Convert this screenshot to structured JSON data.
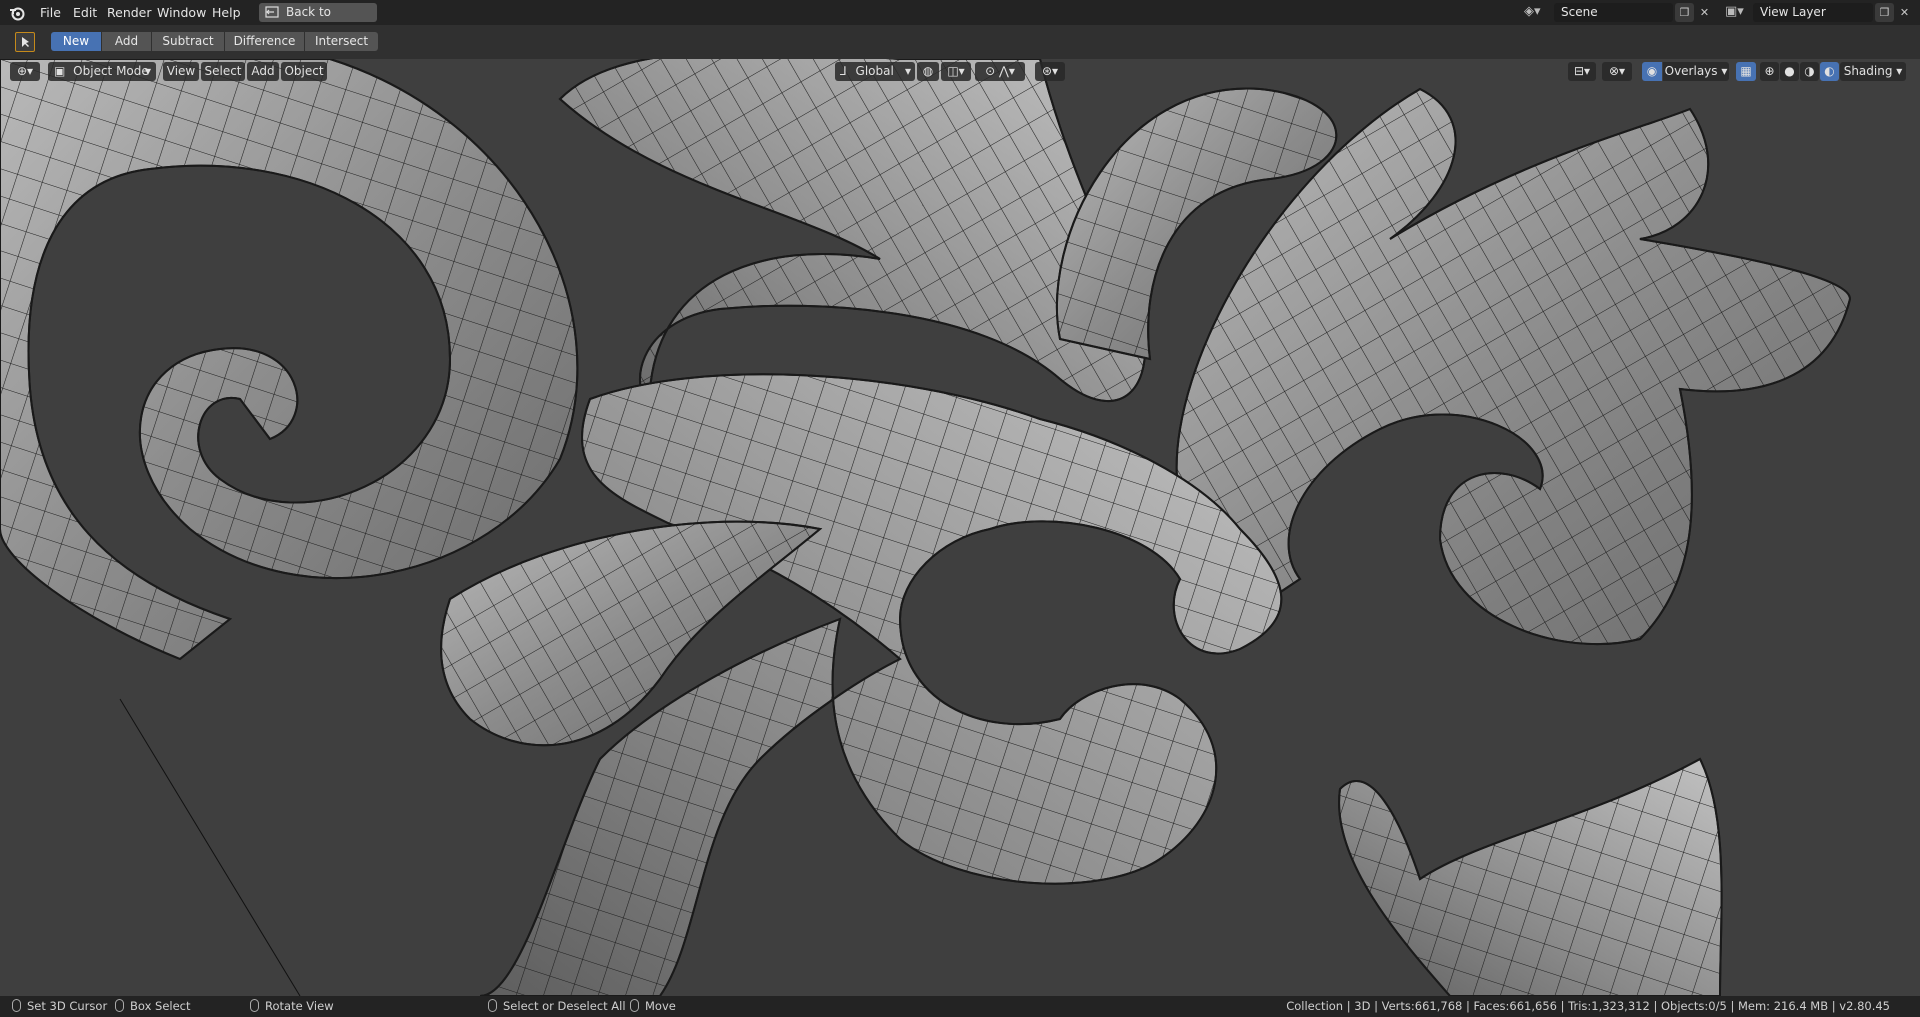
{
  "menu": [
    "File",
    "Edit",
    "Render",
    "Window",
    "Help"
  ],
  "back_button": "Back to Previous",
  "scene": {
    "label": "Scene"
  },
  "view_layer": {
    "label": "View Layer"
  },
  "tool_header": {
    "modes": [
      "New",
      "Add",
      "Subtract",
      "Difference",
      "Intersect"
    ],
    "active_mode": "New"
  },
  "viewport_header": {
    "mode": "Object Mode",
    "menus": [
      "View",
      "Select",
      "Add",
      "Object"
    ],
    "orientation": "Global",
    "overlays": "Overlays",
    "shading": "Shading"
  },
  "status": {
    "set_cursor": "Set 3D Cursor",
    "box_select": "Box Select",
    "rotate_view": "Rotate View",
    "select_all": "Select or Deselect All",
    "move": "Move",
    "stats": "Collection | 3D | Verts:661,768 | Faces:661,656 | Tris:1,323,312 | Objects:0/5 | Mem: 216.4 MB | v2.80.45"
  },
  "colors": {
    "accent": "#4772b3",
    "topbar": "#232323",
    "viewport_bg": "#3f3f3f",
    "tool_outline": "#c58a1b"
  },
  "icons": [
    "blender-logo-icon",
    "back-icon",
    "scene-icon",
    "view-layer-icon",
    "select-box-tool-icon",
    "viewport-type-icon",
    "object-mode-icon",
    "orientation-icon",
    "pivot-icon",
    "snap-icon",
    "proportional-icon",
    "gizmo-icon",
    "overlays-icon",
    "xray-icon",
    "wireframe-shading-icon",
    "solid-shading-icon",
    "material-shading-icon",
    "rendered-shading-icon",
    "mouse-icon"
  ]
}
